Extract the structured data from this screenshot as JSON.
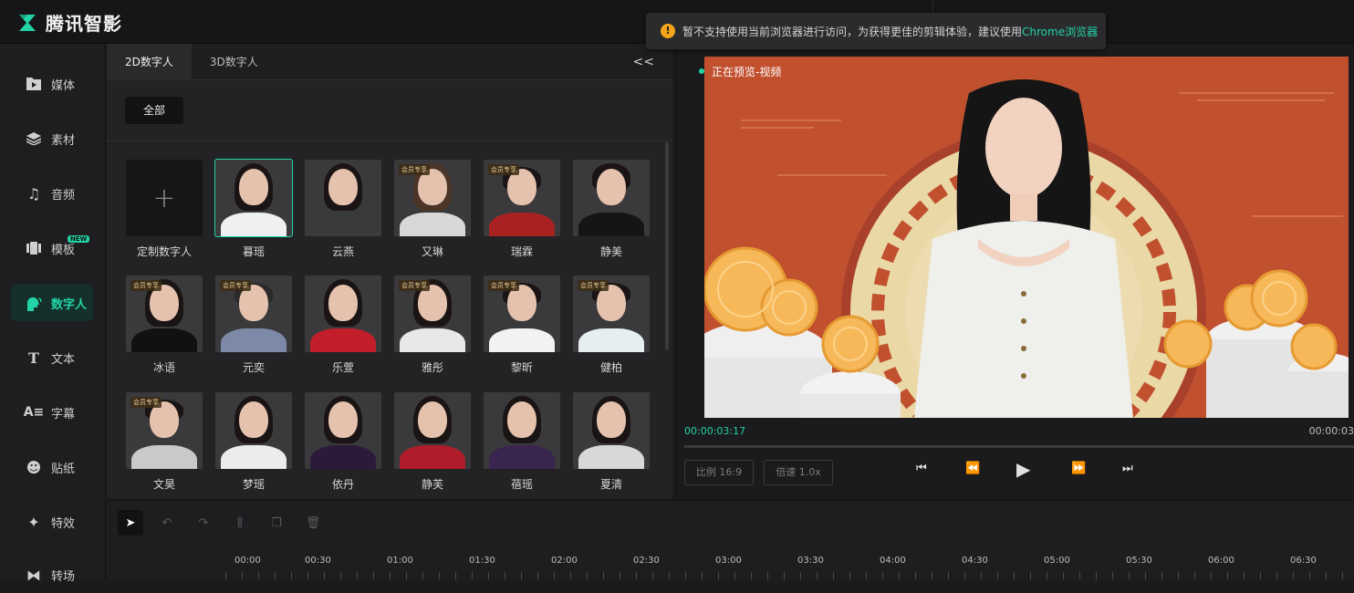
{
  "app": {
    "title": "腾讯智影",
    "brand_color": "#22d3a6"
  },
  "toast": {
    "text": "暂不支持使用当前浏览器进行访问，为获得更佳的剪辑体验，建议使用",
    "link": "Chrome浏览器",
    "icon": "warning-icon"
  },
  "sidebar": {
    "items": [
      {
        "label": "媒体",
        "icon": "media-icon"
      },
      {
        "label": "素材",
        "icon": "layers-icon"
      },
      {
        "label": "音频",
        "icon": "music-icon"
      },
      {
        "label": "模板",
        "icon": "template-icon",
        "badge": "NEW"
      },
      {
        "label": "数字人",
        "icon": "digital-human-icon",
        "active": true
      },
      {
        "label": "文本",
        "icon": "text-icon"
      },
      {
        "label": "字幕",
        "icon": "subtitle-icon"
      },
      {
        "label": "贴纸",
        "icon": "sticker-icon"
      },
      {
        "label": "特效",
        "icon": "effects-icon"
      },
      {
        "label": "转场",
        "icon": "transition-icon"
      }
    ]
  },
  "panel": {
    "tabs": [
      "2D数字人",
      "3D数字人"
    ],
    "collapse": "<<",
    "filter": "全部",
    "vip_label": "会员专享",
    "avatars": [
      {
        "name": "定制数字人",
        "custom": true,
        "plus": "+"
      },
      {
        "name": "暮瑶"
      },
      {
        "name": "云燕"
      },
      {
        "name": "又琳"
      },
      {
        "name": "瑞霖"
      },
      {
        "name": "静美"
      },
      {
        "name": "冰语"
      },
      {
        "name": "元奕"
      },
      {
        "name": "乐萱"
      },
      {
        "name": "雅彤"
      },
      {
        "name": "黎昕"
      },
      {
        "name": "健柏"
      },
      {
        "name": "文昊"
      },
      {
        "name": "梦瑶"
      },
      {
        "name": "依丹"
      },
      {
        "name": "静芙"
      },
      {
        "name": "蓓瑶"
      },
      {
        "name": "夏清"
      }
    ]
  },
  "preview": {
    "label": "正在预览-视频",
    "time_current": "00:00:03:17",
    "time_total": "00:00:03",
    "ratio": "比例 16:9",
    "speed": "倍速 1.0x"
  },
  "timeline": {
    "ticks": [
      "00:00",
      "00:30",
      "01:00",
      "01:30",
      "02:00",
      "02:30",
      "03:00",
      "03:30",
      "04:00",
      "04:30",
      "05:00",
      "05:30",
      "06:00",
      "06:30"
    ]
  }
}
